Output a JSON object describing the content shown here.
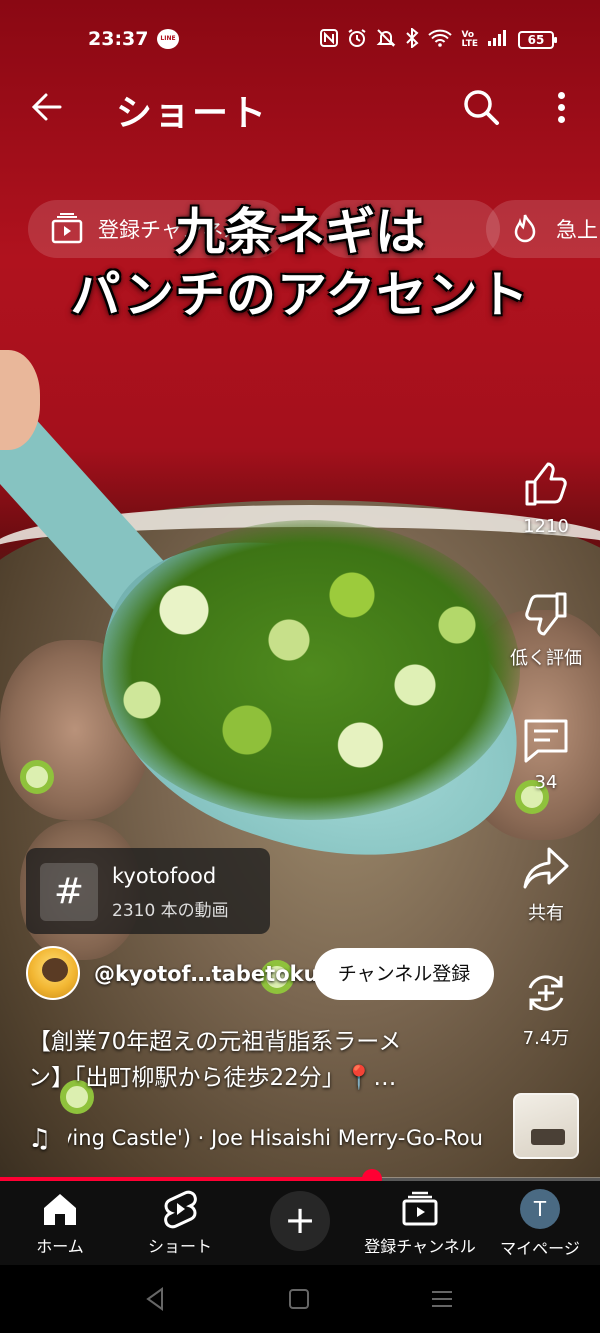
{
  "status_bar": {
    "time": "23:37",
    "line_badge": "LINE",
    "battery": "65"
  },
  "header": {
    "title": "ショート"
  },
  "chips": [
    {
      "label": "登録チャンネル",
      "icon": "subscriptions-icon"
    },
    {
      "label": "",
      "icon": "trending-icon"
    },
    {
      "label": "急上",
      "icon": "fire-icon"
    }
  ],
  "overlay_caption": {
    "line1": "九条ネギは",
    "line2": "パンチのアクセント"
  },
  "actions": {
    "like_count": "1210",
    "dislike_label": "低く評価",
    "comment_count": "34",
    "share_label": "共有",
    "remix_count": "7.4万"
  },
  "hashtag_card": {
    "icon_glyph": "#",
    "name": "kyotofood",
    "count": "2310 本の動画"
  },
  "channel": {
    "handle": "@kyotof…tabetoku",
    "subscribe_label": "チャンネル登録"
  },
  "video": {
    "title_line1": "【創業70年超えの元祖背脂系ラーメ",
    "title_line2": "ン】「出町柳駅から徒歩22分」📍…",
    "music": "ving Castle') · Joe Hisaishi    Merry-Go-Rou",
    "progress": 0.62
  },
  "bottom_nav": {
    "home": "ホーム",
    "shorts": "ショート",
    "create": "+",
    "subscriptions": "登録チャンネル",
    "me": "マイページ",
    "me_initial": "T"
  },
  "colors": {
    "accent": "#ff0033",
    "nav_bg": "#0f0f0f"
  }
}
